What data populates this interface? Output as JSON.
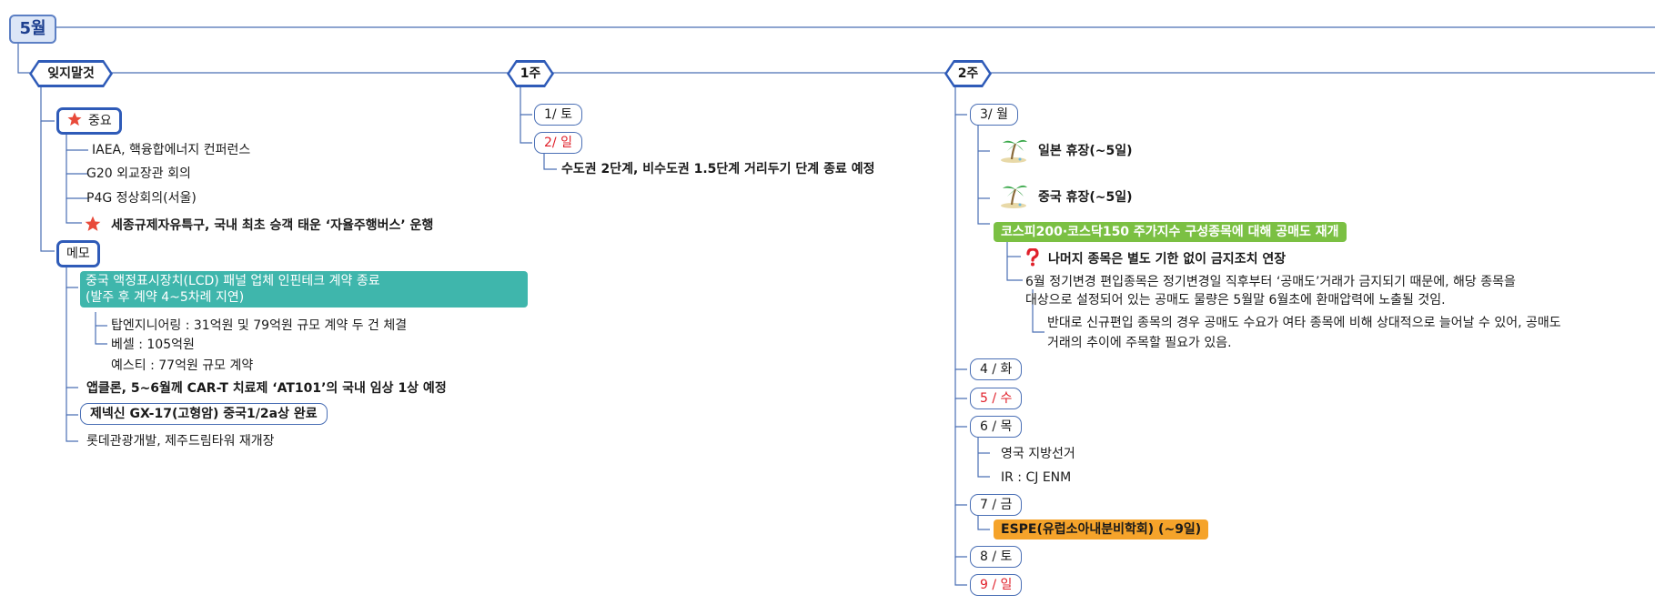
{
  "root": {
    "label": "5월"
  },
  "branches": {
    "checklist": {
      "label": "잊지말것"
    },
    "week1": {
      "label": "1주"
    },
    "week2": {
      "label": "2주"
    }
  },
  "important": {
    "label": "중요",
    "items": [
      "IAEA, 핵융합에너지 컨퍼런스",
      "G20 외교장관 회의",
      "P4G 정상회의(서울)",
      "세종규제자유특구, 국내 최초 승객 태운 ‘자율주행버스’ 운행"
    ]
  },
  "memo": {
    "label": "메모",
    "lcd_line1": "중국 액정표시장치(LCD) 패널 업체 인핀테크 계약 종료",
    "lcd_line2": "(발주 후 계약 4~5차례 지연)",
    "sub": [
      "탑엔지니어링 : 31억원 및 79억원 규모 계약 두 건 체결",
      "베셀 : 105억원",
      "예스티 : 77억원 규모 계약"
    ],
    "items": [
      "앱클론, 5~6월께 CAR-T 치료제 ‘AT101’의 국내 임상 1상 예정",
      "제넥신 GX-17(고형암) 중국1/2a상 완료",
      "롯데관광개발, 제주드림타워 재개장"
    ]
  },
  "week1": {
    "day1": "1/ 토",
    "day2": "2/ 일",
    "day2_note": "수도권 2단계, 비수도권 1.5단계 거리두기 단계 종료 예정"
  },
  "week2": {
    "mon": "3/ 월",
    "japan": "일본 휴장(~5일)",
    "china": "중국 휴장(~5일)",
    "short_sale": "코스피200·코스닥150 주가지수 구성종목에 대해 공매도 재개",
    "rest": "나머지 종목은 별도 기한 없이 금지조치 연장",
    "rebalance_line1": "6월 정기변경 편입종목은 정기변경일 직후부터 ‘공매도’거래가 금지되기 때문에, 해당 종목을",
    "rebalance_line2": "대상으로 설정되어 있는 공매도 물량은 5월말 6월초에 환매압력에 노출될 것임.",
    "newly_line1": "반대로 신규편입 종목의 경우 공매도 수요가 여타 종목에 비해 상대적으로 늘어날 수 있어, 공매도",
    "newly_line2": "거래의 추이에 주목할 필요가 있음.",
    "tue": "4 / 화",
    "wed": "5 / 수",
    "thu": "6 / 목",
    "uk": "영국 지방선거",
    "ir": "IR : CJ ENM",
    "fri": "7 / 금",
    "espe": "ESPE(유럽소아내분비학회)   (~9일)",
    "sat": "8 / 토",
    "sun": "9 / 일"
  },
  "icons": {
    "star": "star-icon",
    "question": "question-icon",
    "palm": "palm-tree-icon"
  },
  "colors": {
    "line": "#4a6fb5",
    "border": "#2f5bb8",
    "teal": "#3fb6ac",
    "green": "#7bc043",
    "orange": "#f5a32a",
    "holiday": "#e0202a"
  }
}
